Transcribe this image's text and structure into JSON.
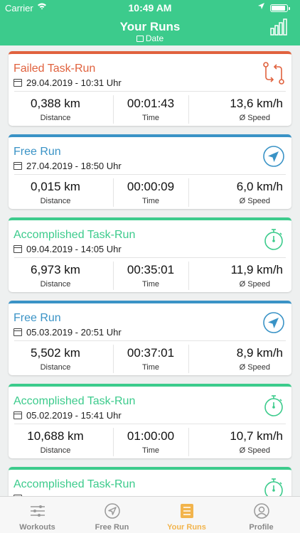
{
  "status": {
    "carrier": "Carrier",
    "time": "10:49 AM"
  },
  "header": {
    "title": "Your Runs",
    "subtitle": "Date"
  },
  "colors": {
    "accent": "#3ccb8c",
    "failed": "#e0623e",
    "free": "#3a93c6",
    "accomplished": "#3ccb8c",
    "tab_active": "#f2b44c"
  },
  "labels": {
    "distance": "Distance",
    "time": "Time",
    "speed": "Ø Speed"
  },
  "runs": [
    {
      "type": "Failed Task-Run",
      "date": "29.04.2019 - 10:31 Uhr",
      "distance": "0,388 km",
      "time": "00:01:43",
      "speed": "13,6 km/h",
      "icon": "swap-route-icon"
    },
    {
      "type": "Free Run",
      "date": "27.04.2019 - 18:50 Uhr",
      "distance": "0,015 km",
      "time": "00:00:09",
      "speed": "6,0 km/h",
      "icon": "navigation-icon"
    },
    {
      "type": "Accomplished Task-Run",
      "date": "09.04.2019 - 14:05 Uhr",
      "distance": "6,973 km",
      "time": "00:35:01",
      "speed": "11,9 km/h",
      "icon": "stopwatch-icon"
    },
    {
      "type": "Free Run",
      "date": "05.03.2019 - 20:51 Uhr",
      "distance": "5,502 km",
      "time": "00:37:01",
      "speed": "8,9 km/h",
      "icon": "navigation-icon"
    },
    {
      "type": "Accomplished Task-Run",
      "date": "05.02.2019 - 15:41 Uhr",
      "distance": "10,688 km",
      "time": "01:00:00",
      "speed": "10,7 km/h",
      "icon": "stopwatch-icon"
    },
    {
      "type": "Accomplished Task-Run",
      "date": "",
      "distance": "",
      "time": "",
      "speed": "",
      "icon": "stopwatch-icon"
    }
  ],
  "tabs": [
    {
      "label": "Workouts",
      "icon": "sliders-icon"
    },
    {
      "label": "Free Run",
      "icon": "navigation-icon"
    },
    {
      "label": "Your Runs",
      "icon": "list-icon",
      "active": true
    },
    {
      "label": "Profile",
      "icon": "profile-icon"
    }
  ]
}
